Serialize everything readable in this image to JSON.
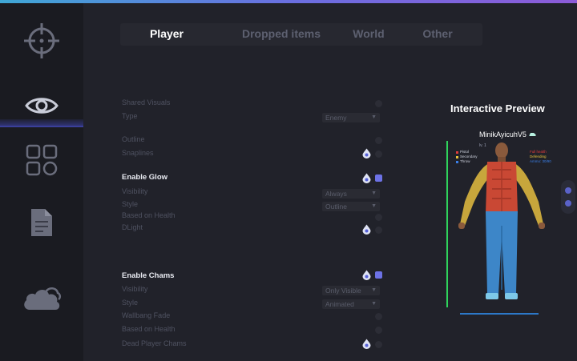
{
  "window": {
    "accent_colors": [
      "#3fa7d6",
      "#8c5bd8"
    ]
  },
  "sidebar": {
    "items": [
      {
        "icon": "crosshair-icon",
        "active": false
      },
      {
        "icon": "eye-icon",
        "active": true
      },
      {
        "icon": "grid-icon",
        "active": false
      },
      {
        "icon": "document-icon",
        "active": false
      },
      {
        "icon": "cloud-icon",
        "active": false
      }
    ]
  },
  "tabs": [
    {
      "label": "Player",
      "active": true
    },
    {
      "label": "Dropped items",
      "active": false
    },
    {
      "label": "World",
      "active": false
    },
    {
      "label": "Other",
      "active": false
    }
  ],
  "settings": {
    "shared_visuals": "Shared Visuals",
    "type_label": "Type",
    "type_value": "Enemy",
    "outline": "Outline",
    "snaplines": "Snaplines",
    "enable_glow": "Enable Glow",
    "glow_visibility_label": "Visibility",
    "glow_visibility_value": "Always",
    "glow_style_label": "Style",
    "glow_style_value": "Outline",
    "glow_health": "Based on Health",
    "dlight": "DLight",
    "enable_chams": "Enable Chams",
    "chams_visibility_label": "Visibility",
    "chams_visibility_value": "Only Visible",
    "chams_style_label": "Style",
    "chams_style_value": "Animated",
    "wallbang_fade": "Wallbang Fade",
    "chams_health": "Based on Health",
    "dead_player_chams": "Dead Player Chams"
  },
  "preview": {
    "title": "Interactive Preview",
    "player_name": "MinikAyicuhV5",
    "level": "lv. 1",
    "legend": [
      {
        "label": "Pistol",
        "color": "#e23b3b"
      },
      {
        "label": "Secondary",
        "color": "#e8c23a"
      },
      {
        "label": "Throw",
        "color": "#3a7fe8"
      }
    ],
    "legend_right": [
      {
        "label": "Full health",
        "color": "#e23b3b"
      },
      {
        "label": "Defending",
        "color": "#e8c23a"
      },
      {
        "label": "Ammo: 30/90",
        "color": "#3a7fe8"
      }
    ],
    "health_color": "#2fd45c"
  }
}
